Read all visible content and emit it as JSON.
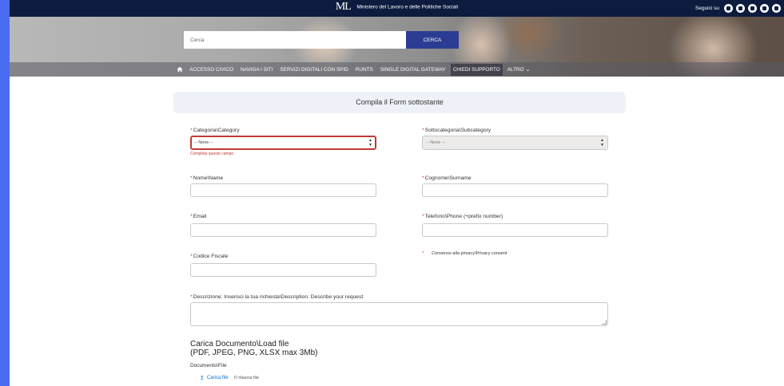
{
  "topbar": {
    "logo": "ML",
    "ministry": "Ministero del Lavoro e delle Politiche Sociali",
    "follow_label": "Seguici su",
    "social_icons": [
      "facebook-icon",
      "twitter-icon",
      "instagram-icon",
      "youtube-icon",
      "linkedin-icon"
    ]
  },
  "search": {
    "placeholder": "Cerca",
    "button_label": "CERCA"
  },
  "nav": {
    "items": [
      "ACCESSO CIVICO",
      "NAVIGA I SITI",
      "SERVIZI DIGITALI CON SPID",
      "RUNTS",
      "SINGLE DIGITAL GATEWAY",
      "CHIEDI SUPPORTO",
      "ALTRO"
    ],
    "active": "CHIEDI SUPPORTO"
  },
  "form": {
    "header": "Compila il Form sottostante",
    "required_mark": "*",
    "categoria": {
      "label": "Categoria\\Category",
      "value": "-- None --",
      "error": "Completa questo campo"
    },
    "sottocategoria": {
      "label": "Sottocategoria\\Subcategory",
      "value": "-- None --"
    },
    "nome": {
      "label": "Nome\\Name"
    },
    "cognome": {
      "label": "Cognome\\Surname"
    },
    "email": {
      "label": "Email"
    },
    "telefono": {
      "label": "Telefono\\Phone (+prefix number)"
    },
    "codice_fiscale": {
      "label": "Codice Fiscale"
    },
    "consenso": {
      "label": "Consenso alla privacy\\Privacy consent"
    },
    "descrizione": {
      "label": "Descrizione: Inserisci la tua richiesta\\Description: Describe your request"
    },
    "upload": {
      "title_line1": "Carica Documento\\Load file",
      "title_line2": "(PDF, JPEG, PNG, XLSX max 3Mb)",
      "subtitle": "Documento\\File",
      "button_label": "Carica file",
      "drop_label": "O rilascia file"
    }
  }
}
